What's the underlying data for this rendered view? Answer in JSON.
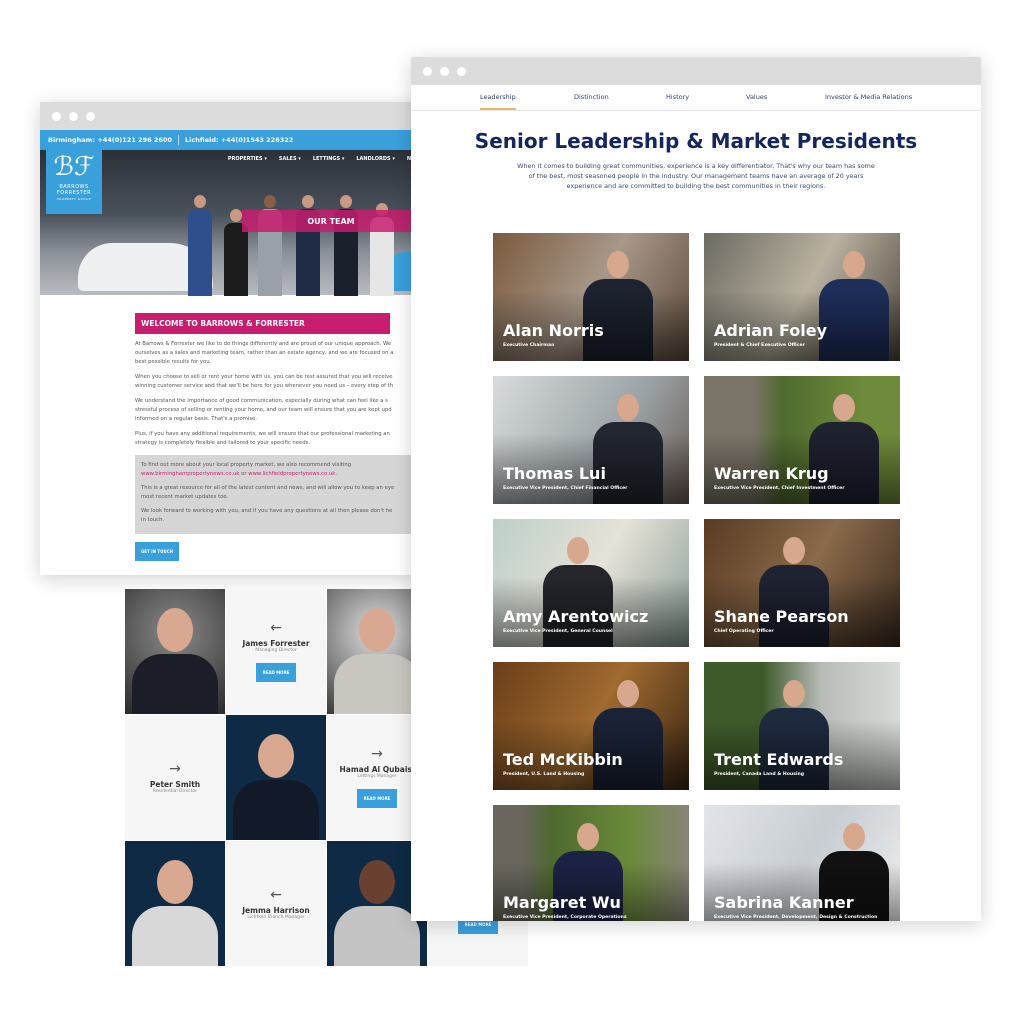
{
  "back_site": {
    "contact_bar": {
      "birmingham": "Birmingham: +44(0)121 296 2600",
      "lichfield": "Lichfield: +44(0)1543 226322"
    },
    "logo": {
      "monogram": "BF",
      "name_line1": "BARROWS",
      "name_line2": "FORRESTER",
      "tagline": "PROPERTY GROUP"
    },
    "nav": [
      "PROPERTIES ▾",
      "SALES ▾",
      "LETTINGS ▾",
      "LANDLORDS ▾",
      "NEW"
    ],
    "hero_banner": "OUR TEAM",
    "welcome_heading": "WELCOME TO BARROWS & FORRESTER",
    "paragraphs": [
      "At Barrows & Forrester we like to do things differently and are proud of our unique approach. We",
      "ourselves as a sales and marketing team, rather than an estate agency, and we are focused on a",
      "best possible results for you.",
      "When you choose to sell or rent your home with us, you can be rest assured that you will receive",
      "winning customer service and that we'll be here for you whenever you need us – every step of th",
      "We understand the importance of good communication, especially during what can feel like a s",
      "stressful process of selling or renting your home, and our team will ensure that you are kept upd",
      "informed on a regular basis. That's a promise.",
      "Plus, if you have any additional requirements, we will ensure that our professional marketing an",
      "strategy is completely flexible and tailored to your specific needs."
    ],
    "grey_box": {
      "line1": "To find out more about your local property market, we also recommend visiting",
      "link1": "www.birminghampropertynews.co.uk",
      "or": " or ",
      "link2": "www.lichfieldpropertynews.co.uk.",
      "line2a": "This is a great resource for all of the latest content and news, and will allow you to keep an eye",
      "line2b": "most recent market updates too.",
      "line3a": "We look forward to working with you, and if you have any questions at all then please don't he",
      "line3b": "in touch."
    },
    "cta": "GET IN TOUCH",
    "team": [
      {
        "name": "James Forrester",
        "role": "Managing Director",
        "button": "READ MORE"
      },
      {
        "name": "Peter Smith",
        "role": "Residential Director"
      },
      {
        "name": "Hamad Al Qubaisi",
        "role": "Lettings Manager",
        "button": "READ MORE"
      },
      {
        "name": "Jemma Harrison",
        "role": "Lichfield Branch Manager"
      }
    ],
    "extra_button": "READ MORE",
    "colors": {
      "blue": "#3aa0dc",
      "magenta": "#c81c6e"
    }
  },
  "front_site": {
    "tabs": [
      {
        "label": "Leadership",
        "active": true
      },
      {
        "label": "Distinction"
      },
      {
        "label": "History"
      },
      {
        "label": "Values"
      },
      {
        "label": "Investor & Media Relations"
      }
    ],
    "title": "Senior Leadership & Market Presidents",
    "intro": "When it comes to building great communities, experience is a key differentiator. That's why our team has some of the best, most seasoned people in the industry. Our management teams have an average of 20 years experience and are committed to building the best communities in their regions.",
    "leaders": [
      {
        "name": "Alan Norris",
        "title": "Executive Chairman"
      },
      {
        "name": "Adrian Foley",
        "title": "President & Chief Executive Officer"
      },
      {
        "name": "Thomas Lui",
        "title": "Executive Vice President, Chief Financial Officer"
      },
      {
        "name": "Warren Krug",
        "title": "Executive Vice President, Chief Investment Officer"
      },
      {
        "name": "Amy Arentowicz",
        "title": "Executive Vice President, General Counsel"
      },
      {
        "name": "Shane Pearson",
        "title": "Chief Operating Officer"
      },
      {
        "name": "Ted McKibbin",
        "title": "President, U.S. Land & Housing"
      },
      {
        "name": "Trent Edwards",
        "title": "President, Canada Land & Housing"
      },
      {
        "name": "Margaret Wu",
        "title": "Executive Vice President, Corporate Operations"
      },
      {
        "name": "Sabrina Kanner",
        "title": "Executive Vice President, Development, Design & Construction"
      }
    ],
    "colors": {
      "navy": "#13275e",
      "tab_underline": "#e8b86a"
    }
  }
}
